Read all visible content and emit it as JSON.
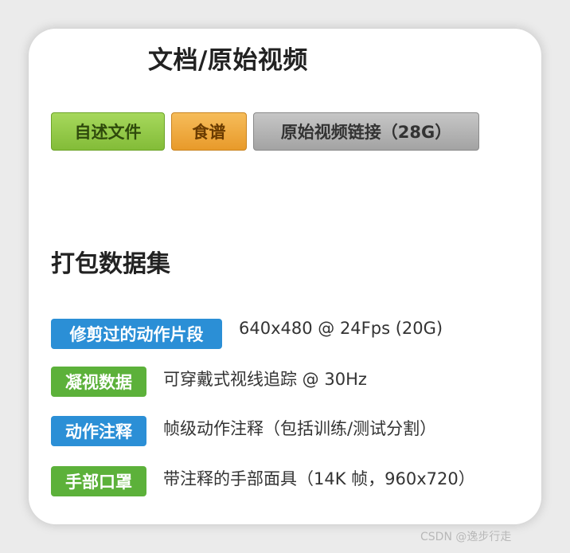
{
  "header": {
    "title": "文档/原始视频"
  },
  "buttons": {
    "readme": "自述文件",
    "recipe": "食谱",
    "raw_video_link": "原始视频链接（28G）"
  },
  "section": {
    "title": "打包数据集"
  },
  "items": [
    {
      "badge": "修剪过的动作片段",
      "badge_color": "#2b8fd6",
      "text": "640x480 @ 24Fps (20G)"
    },
    {
      "badge": "凝视数据",
      "badge_color": "#5cb13a",
      "text": "可穿戴式视线追踪 @ 30Hz"
    },
    {
      "badge": "动作注释",
      "badge_color": "#2b8fd6",
      "text": "帧级动作注释（包括训练/测试分割）"
    },
    {
      "badge": "手部口罩",
      "badge_color": "#5cb13a",
      "text": "带注释的手部面具（14K 帧，960x720）"
    }
  ],
  "watermark": "CSDN @逸步行走"
}
